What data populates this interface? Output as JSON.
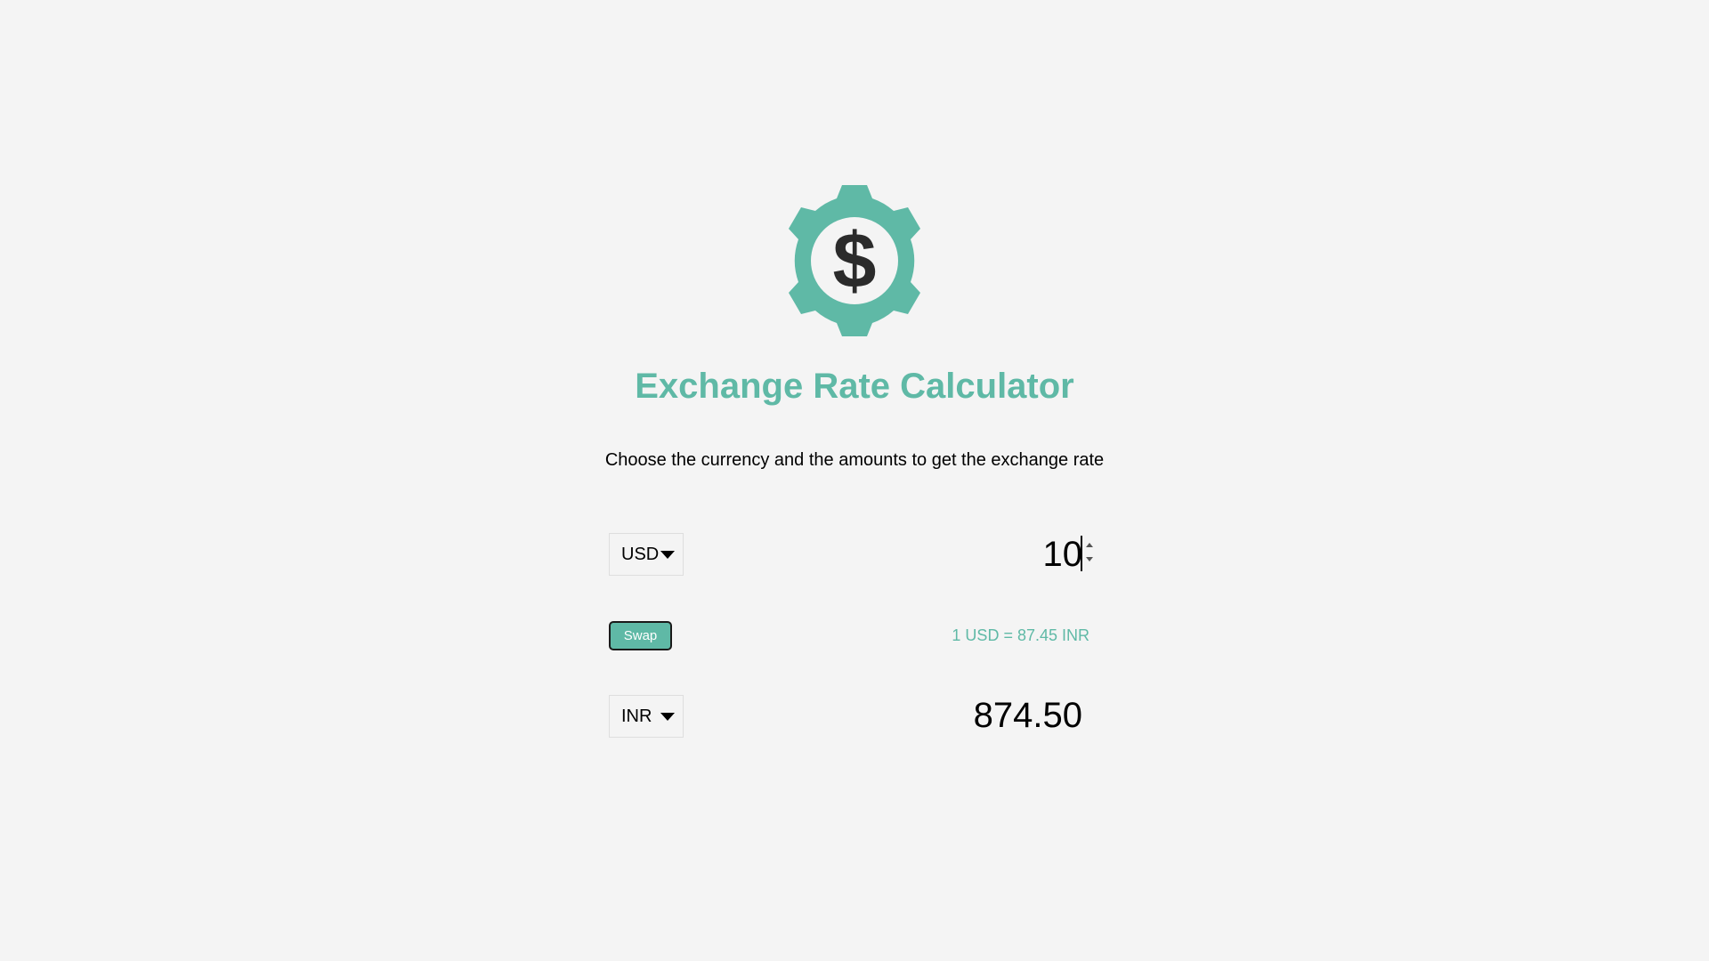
{
  "app": {
    "title": "Exchange Rate Calculator",
    "subtitle": "Choose the currency and the amounts to get the exchange rate",
    "logo_icon": "gear-dollar-icon"
  },
  "converter": {
    "from_currency": "USD",
    "from_amount": "10",
    "swap_label": "Swap",
    "rate_text": "1 USD = 87.45 INR",
    "to_currency": "INR",
    "to_amount": "874.50"
  },
  "colors": {
    "accent": "#5fb9a6",
    "background": "#f4f4f4",
    "text": "#000000",
    "icon_dark": "#2b2b2b"
  }
}
